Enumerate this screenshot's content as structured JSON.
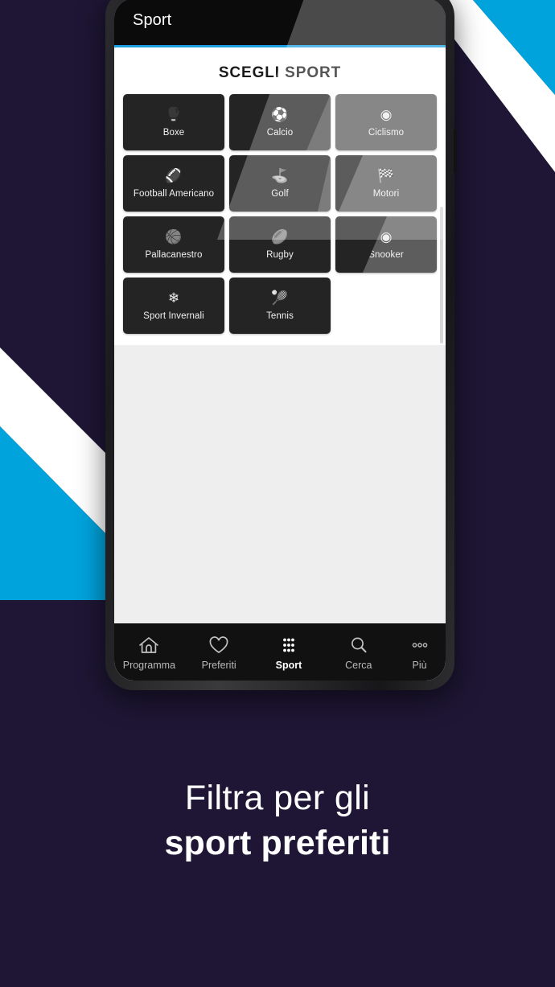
{
  "theme": {
    "background": "#1e1634",
    "stripe_cyan": "#00a3dc",
    "stripe_white": "#ffffff",
    "accent_bar": "#1b9fe0",
    "tile_dark": "#242424",
    "screen_grey": "#eeeeee"
  },
  "app_bar": {
    "title": "Sport"
  },
  "content": {
    "section_title": "SCEGLI SPORT",
    "sports": [
      {
        "label": "Boxe",
        "icon": "boxing-glove-icon",
        "glyph": "🥊",
        "highlighted": false
      },
      {
        "label": "Calcio",
        "icon": "soccer-ball-icon",
        "glyph": "⚽",
        "highlighted": false
      },
      {
        "label": "Ciclismo",
        "icon": "cycling-wheel-icon",
        "glyph": "◉",
        "highlighted": true
      },
      {
        "label": "Football Americano",
        "icon": "football-icon",
        "glyph": "🏈",
        "highlighted": false
      },
      {
        "label": "Golf",
        "icon": "golf-ball-icon",
        "glyph": "⛳",
        "highlighted": false
      },
      {
        "label": "Motori",
        "icon": "checkered-flag-icon",
        "glyph": "🏁",
        "highlighted": true
      },
      {
        "label": "Pallacanestro",
        "icon": "basketball-icon",
        "glyph": "🏀",
        "highlighted": false
      },
      {
        "label": "Rugby",
        "icon": "rugby-ball-icon",
        "glyph": "🏉",
        "highlighted": false
      },
      {
        "label": "Snooker",
        "icon": "snooker-ball-icon",
        "glyph": "◉",
        "highlighted": true
      },
      {
        "label": "Sport Invernali",
        "icon": "snowflake-icon",
        "glyph": "❄",
        "highlighted": false
      },
      {
        "label": "Tennis",
        "icon": "tennis-ball-icon",
        "glyph": "🎾",
        "highlighted": false
      }
    ]
  },
  "bottom_nav": {
    "items": [
      {
        "label": "Programma",
        "icon": "home-icon",
        "active": false
      },
      {
        "label": "Preferiti",
        "icon": "heart-icon",
        "active": false
      },
      {
        "label": "Sport",
        "icon": "grid-dots-icon",
        "active": true
      },
      {
        "label": "Cerca",
        "icon": "search-icon",
        "active": false
      },
      {
        "label": "Più",
        "icon": "more-dots-icon",
        "active": false
      }
    ]
  },
  "caption": {
    "line1": "Filtra per gli",
    "line2": "sport preferiti"
  }
}
